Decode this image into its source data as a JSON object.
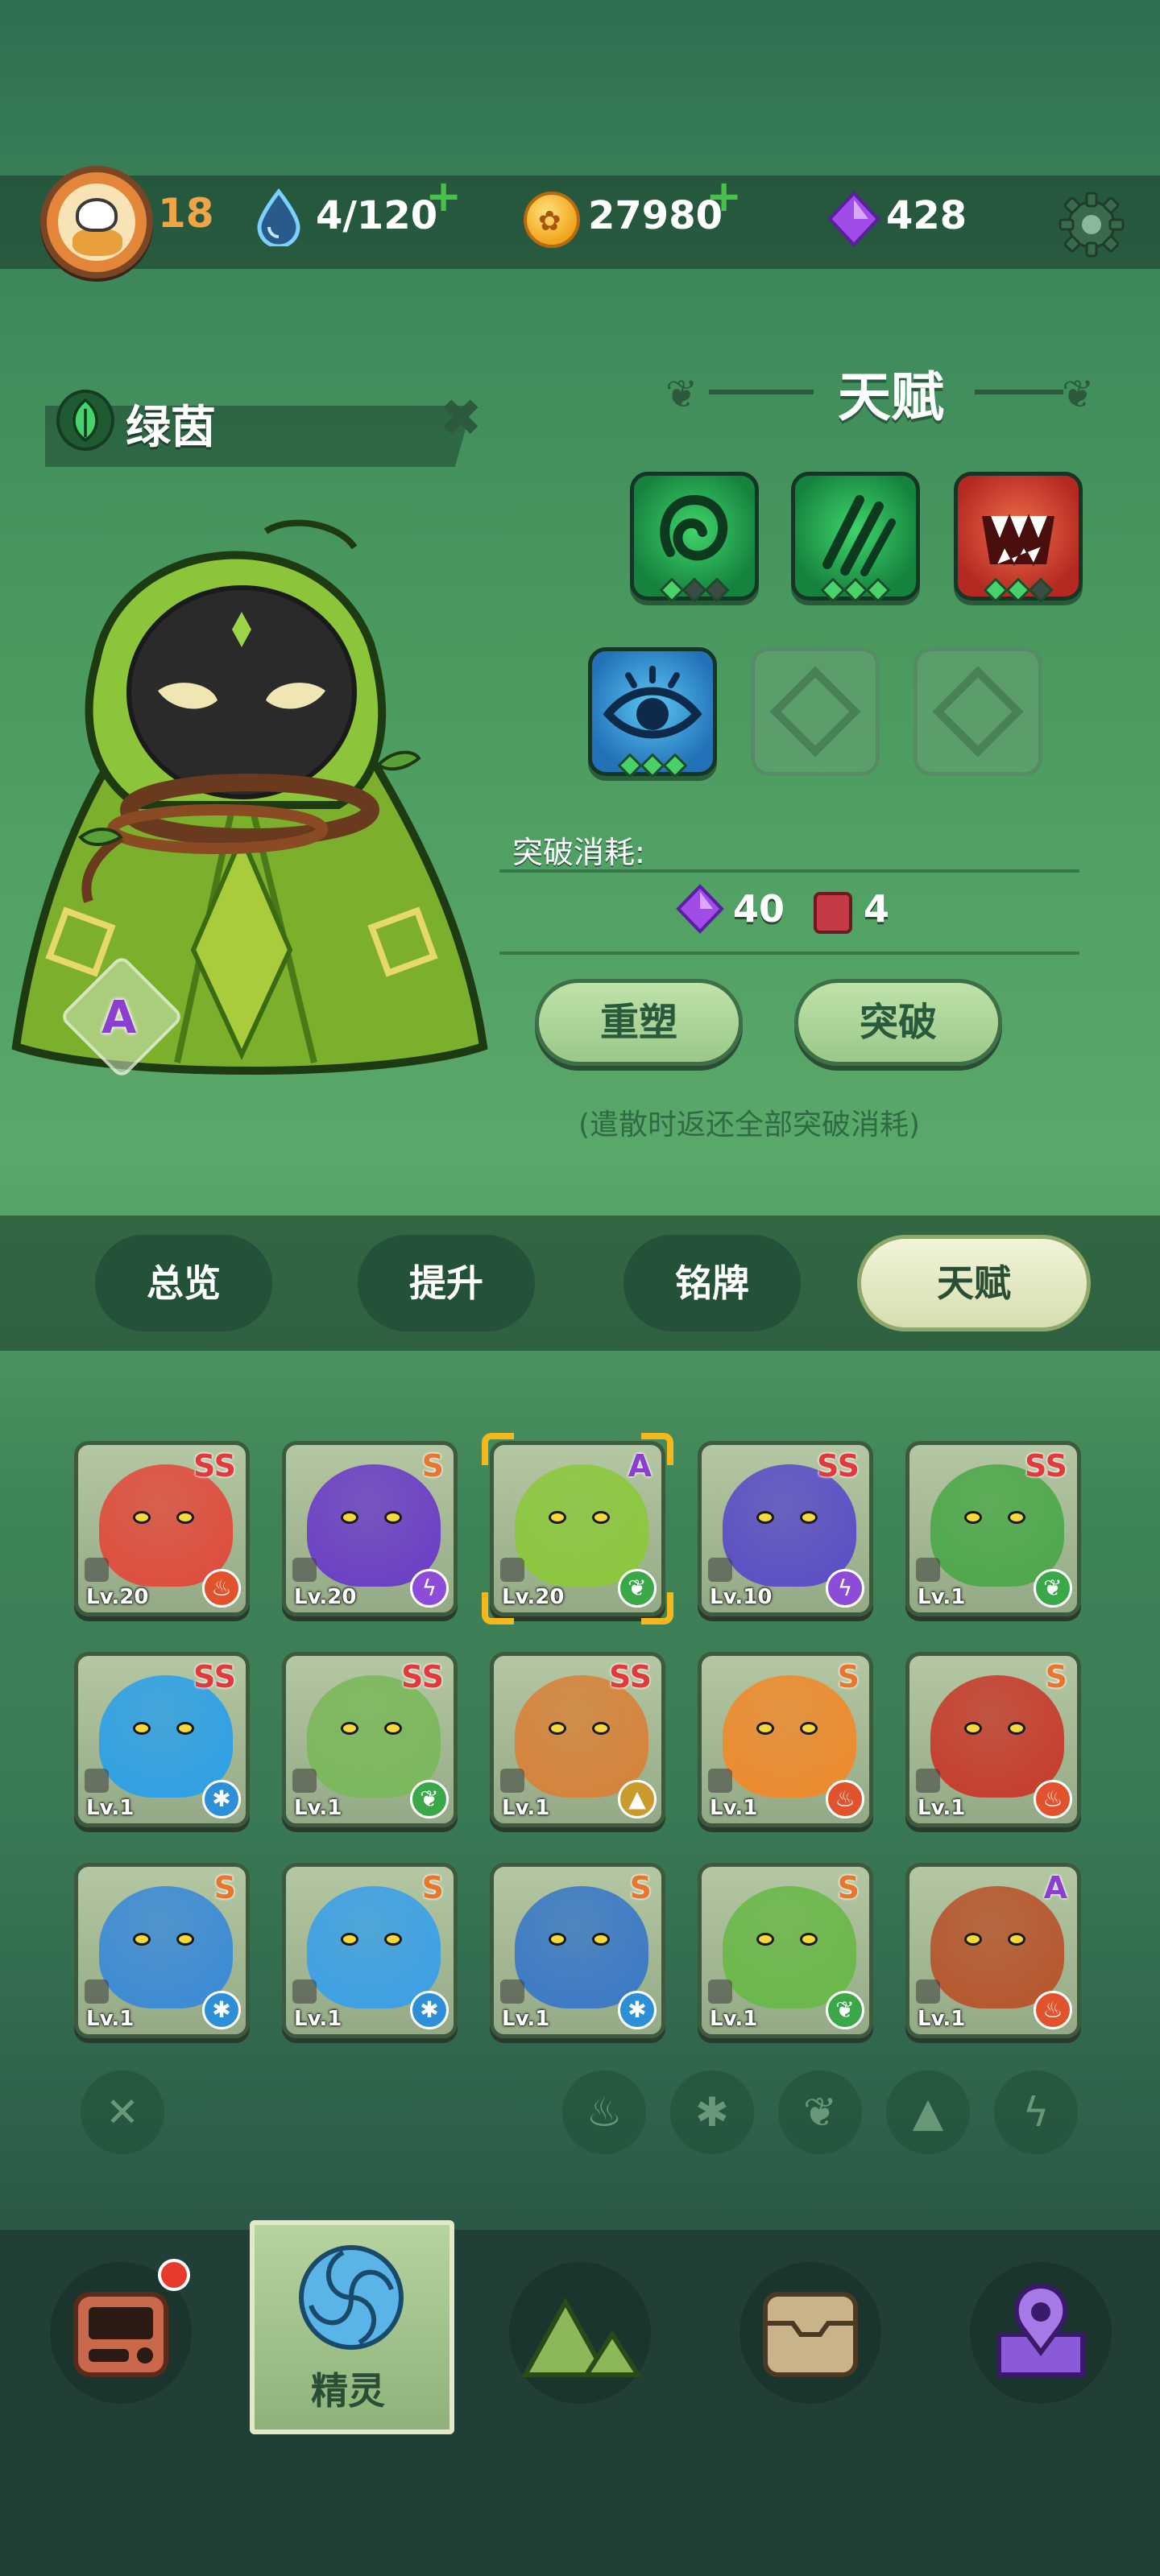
{
  "topbar": {
    "player_level": "18",
    "energy": "4/120",
    "coins": "27980",
    "gems": "428",
    "icons": [
      "avatar-icon",
      "water-drop-icon",
      "paw-coin-icon",
      "purple-gem-icon",
      "gear-icon"
    ]
  },
  "character": {
    "name": "绿茵",
    "rank": "A",
    "element": "leaf"
  },
  "talent": {
    "title": "天赋",
    "slots": [
      {
        "type": "swirl",
        "color": "green",
        "stars_on": 1,
        "stars_total": 3
      },
      {
        "type": "claw",
        "color": "green",
        "stars_on": 3,
        "stars_total": 3
      },
      {
        "type": "fangs",
        "color": "red",
        "stars_on": 2,
        "stars_total": 3
      },
      {
        "type": "eye",
        "color": "blue",
        "stars_on": 3,
        "stars_total": 3
      },
      {
        "type": "empty"
      },
      {
        "type": "empty"
      }
    ],
    "cost_label": "突破消耗:",
    "cost_gems": "40",
    "cost_books": "4",
    "reshape_button": "重塑",
    "breakthrough_button": "突破",
    "note": "(遣散时返还全部突破消耗)"
  },
  "tabs": [
    "总览",
    "提升",
    "铭牌",
    "天赋"
  ],
  "active_tab": "天赋",
  "monsters": [
    {
      "rank": "SS",
      "level": "Lv.20",
      "element": "fire",
      "color": "#e24a3c"
    },
    {
      "rank": "S",
      "level": "Lv.20",
      "element": "bolt",
      "color": "#6a3cc8"
    },
    {
      "rank": "A",
      "level": "Lv.20",
      "element": "leaf",
      "color": "#8cc83c",
      "selected": true
    },
    {
      "rank": "SS",
      "level": "Lv.10",
      "element": "bolt",
      "color": "#5a4cc8"
    },
    {
      "rank": "SS",
      "level": "Lv.1",
      "element": "leaf",
      "color": "#4ca84a"
    },
    {
      "rank": "SS",
      "level": "Lv.1",
      "element": "ice",
      "color": "#2ca0e8"
    },
    {
      "rank": "SS",
      "level": "Lv.1",
      "element": "leaf",
      "color": "#7ab85a"
    },
    {
      "rank": "SS",
      "level": "Lv.1",
      "element": "earth",
      "color": "#d8823a"
    },
    {
      "rank": "S",
      "level": "Lv.1",
      "element": "fire",
      "color": "#f08a2c"
    },
    {
      "rank": "S",
      "level": "Lv.1",
      "element": "fire",
      "color": "#c83a2c"
    },
    {
      "rank": "S",
      "level": "Lv.1",
      "element": "ice",
      "color": "#3a8ad8"
    },
    {
      "rank": "S",
      "level": "Lv.1",
      "element": "ice",
      "color": "#3aa0e8"
    },
    {
      "rank": "S",
      "level": "Lv.1",
      "element": "ice",
      "color": "#3a78c8"
    },
    {
      "rank": "S",
      "level": "Lv.1",
      "element": "leaf",
      "color": "#6ab848"
    },
    {
      "rank": "A",
      "level": "Lv.1",
      "element": "fire",
      "color": "#b8542c"
    }
  ],
  "filters": [
    "close-icon",
    "fire-icon",
    "ice-icon",
    "leaf-icon",
    "earth-icon",
    "bolt-icon"
  ],
  "bottom_nav": {
    "items": [
      "shop-icon",
      "spirit-icon",
      "mountain-icon",
      "chest-icon",
      "map-pin-icon"
    ],
    "active_label": "精灵"
  },
  "colors": {
    "rank_ss": "#e23a3a",
    "rank_s": "#e8762c",
    "rank_a": "#8b3fd0",
    "active_tab": "#e6eac4"
  }
}
